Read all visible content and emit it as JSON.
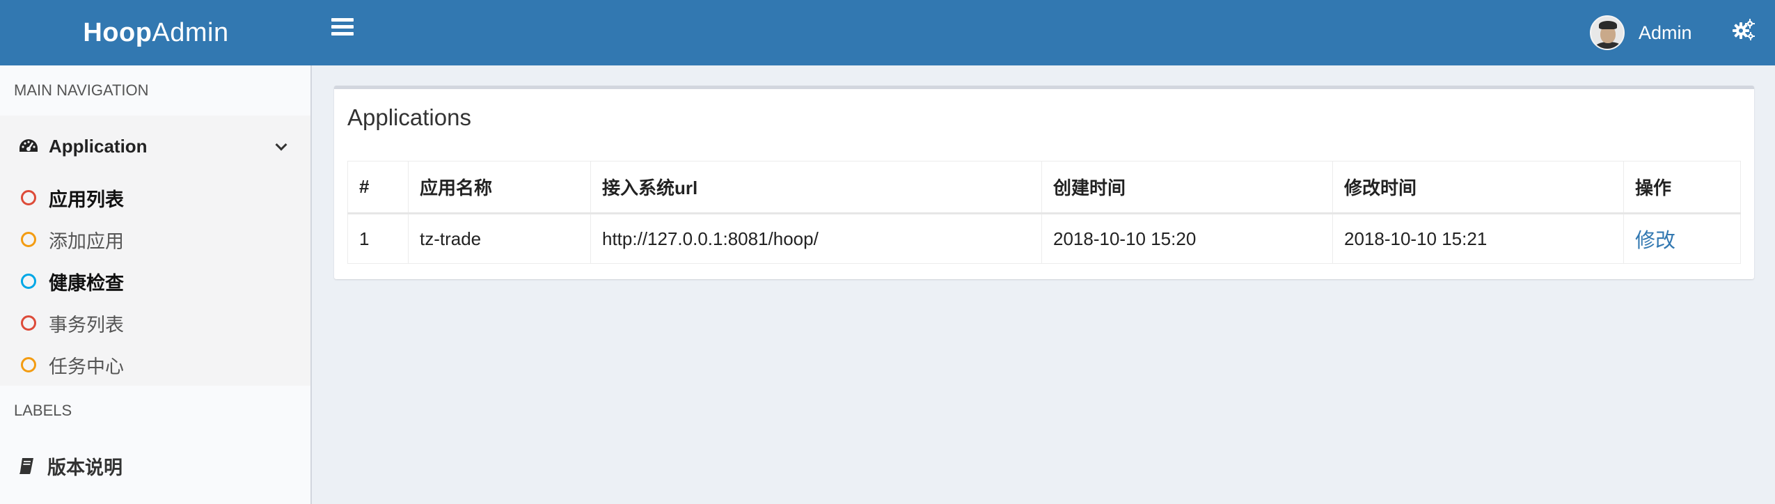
{
  "header": {
    "logo_bold": "Hoop",
    "logo_light": "Admin",
    "username": "Admin"
  },
  "sidebar": {
    "main_nav_label": "MAIN NAVIGATION",
    "tree_label": "Application",
    "items": [
      {
        "label": "应用列表",
        "color": "#dd4b39"
      },
      {
        "label": "添加应用",
        "color": "#f39c12"
      },
      {
        "label": "健康检查",
        "color": "#00a7e6"
      },
      {
        "label": "事务列表",
        "color": "#dd4b39"
      },
      {
        "label": "任务中心",
        "color": "#f39c12"
      }
    ],
    "labels_header": "LABELS",
    "version_label": "版本说明"
  },
  "main": {
    "box_title": "Applications",
    "table": {
      "headers": [
        "#",
        "应用名称",
        "接入系统url",
        "创建时间",
        "修改时间",
        "操作"
      ],
      "rows": [
        [
          "1",
          "tz-trade",
          "http://127.0.0.1:8081/hoop/",
          "2018-10-10 15:20",
          "2018-10-10 15:21",
          "修改"
        ]
      ]
    }
  },
  "colors": {
    "header_bg": "#3278b1",
    "link": "#3278b1",
    "sidebar_bg": "#f9fafc",
    "content_bg": "#ecf0f5"
  }
}
